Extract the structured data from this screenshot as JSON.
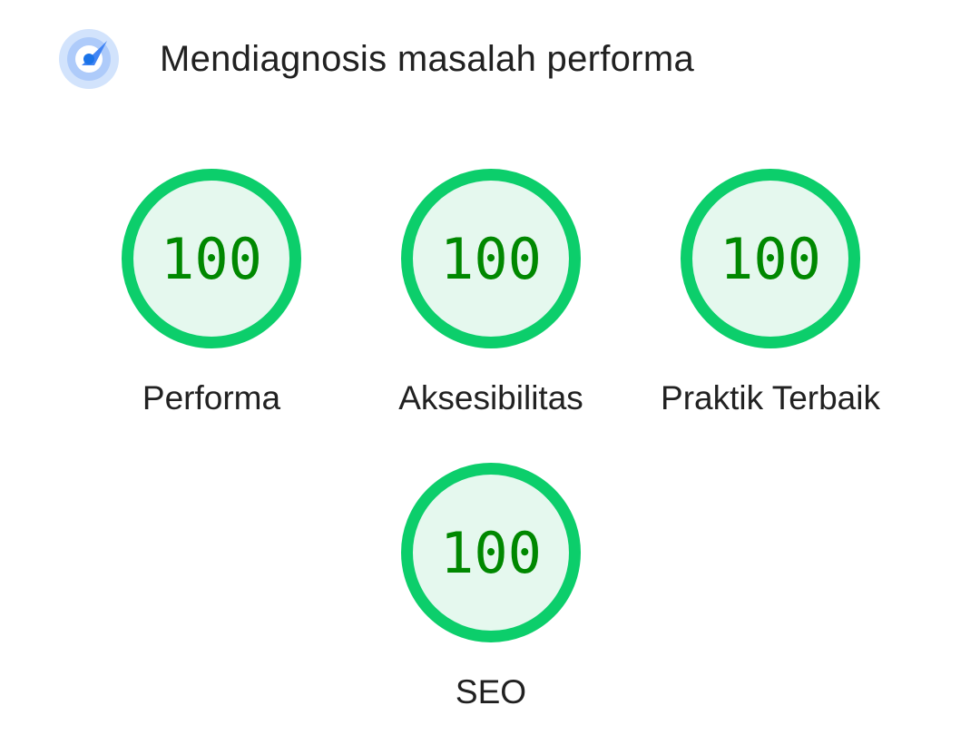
{
  "header": {
    "title": "Mendiagnosis masalah performa",
    "icon": "lighthouse-gauge-icon"
  },
  "gauges": [
    {
      "score": "100",
      "label": "Performa"
    },
    {
      "score": "100",
      "label": "Aksesibilitas"
    },
    {
      "score": "100",
      "label": "Praktik Terbaik"
    },
    {
      "score": "100",
      "label": "SEO"
    }
  ],
  "colors": {
    "pass_ring": "#0cce6b",
    "pass_fill": "#e5f8ee",
    "pass_text": "#008800",
    "icon_blue": "#1a73e8"
  }
}
